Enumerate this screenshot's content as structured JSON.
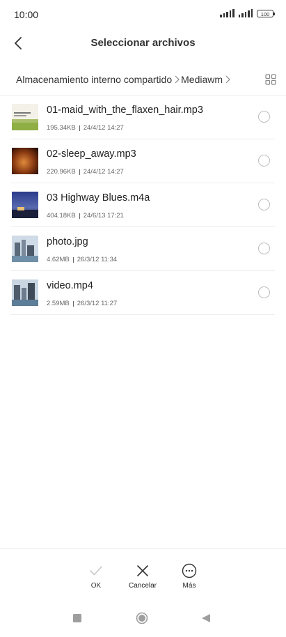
{
  "status": {
    "time": "10:00",
    "battery": "100"
  },
  "header": {
    "title": "Seleccionar archivos"
  },
  "breadcrumb": {
    "items": [
      "Almacenamiento interno compartido",
      "Mediawm"
    ]
  },
  "files": [
    {
      "name": "01-maid_with_the_flaxen_hair.mp3",
      "size": "195.34KB",
      "date": "24/4/12 14:27",
      "icon": "album-art-richard-stoltzman"
    },
    {
      "name": "02-sleep_away.mp3",
      "size": "220.96KB",
      "date": "24/4/12 14:27",
      "icon": "album-art-sleep-away"
    },
    {
      "name": "03 Highway Blues.m4a",
      "size": "404.18KB",
      "date": "24/6/13 17:21",
      "icon": "album-art-highway-blues"
    },
    {
      "name": "photo.jpg",
      "size": "4.62MB",
      "date": "26/3/12 11:34",
      "icon": "photo-thumbnail"
    },
    {
      "name": "video.mp4",
      "size": "2.59MB",
      "date": "26/3/12 11:27",
      "icon": "video-thumbnail"
    }
  ],
  "actions": {
    "ok": "OK",
    "cancel": "Cancelar",
    "more": "Más"
  },
  "colors": {
    "divider": "#ececec",
    "text": "#222222",
    "disabled": "#c8c8c8"
  }
}
